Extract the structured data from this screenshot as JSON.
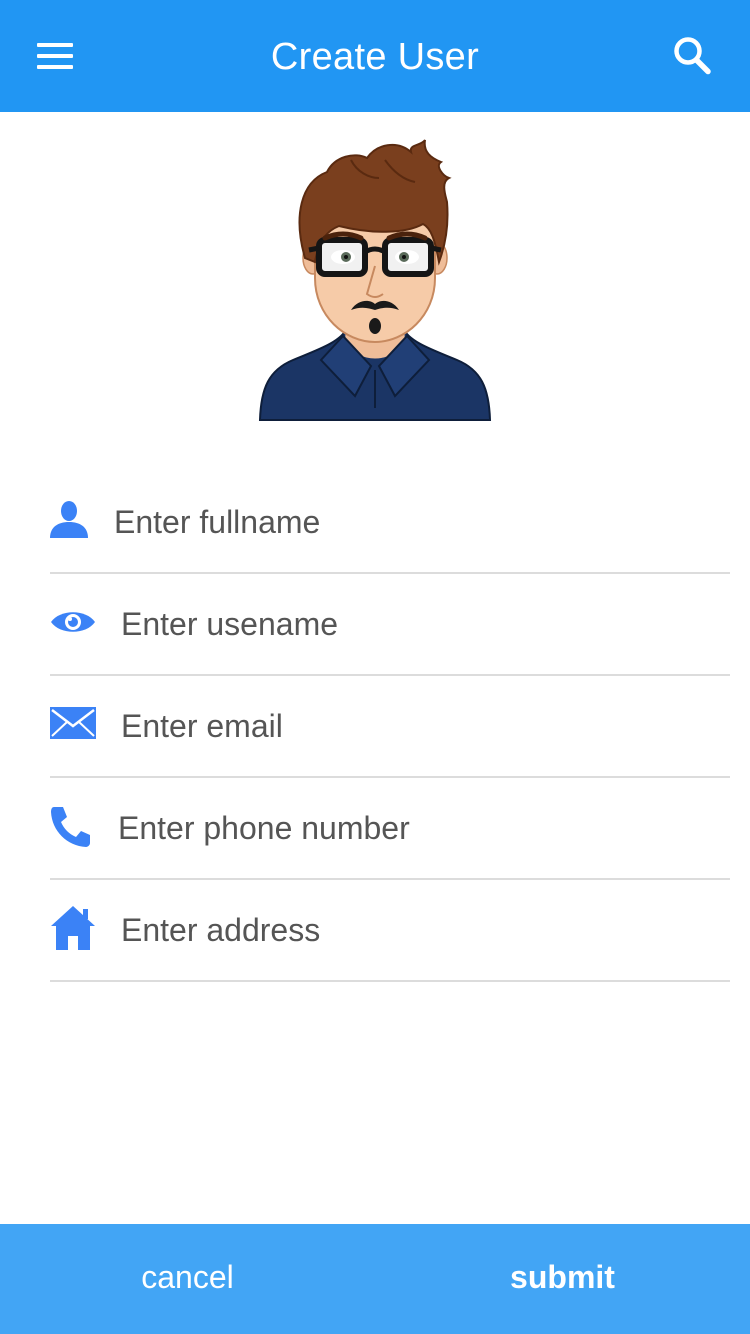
{
  "app_bar": {
    "title": "Create User",
    "background": "#2196f3",
    "menu_icon": "menu-icon",
    "search_icon": "search-icon"
  },
  "avatar": {
    "icon": "user-avatar-illustration"
  },
  "form": {
    "accent_color": "#3b82f6",
    "fields": [
      {
        "icon": "person-icon",
        "placeholder": "Enter fullname",
        "value": ""
      },
      {
        "icon": "eye-icon",
        "placeholder": "Enter usename",
        "value": ""
      },
      {
        "icon": "envelope-icon",
        "placeholder": "Enter email",
        "value": ""
      },
      {
        "icon": "phone-icon",
        "placeholder": "Enter phone number",
        "value": ""
      },
      {
        "icon": "home-icon",
        "placeholder": "Enter address",
        "value": ""
      }
    ]
  },
  "actions": {
    "cancel_label": "cancel",
    "submit_label": "submit",
    "background": "#42a5f5"
  }
}
